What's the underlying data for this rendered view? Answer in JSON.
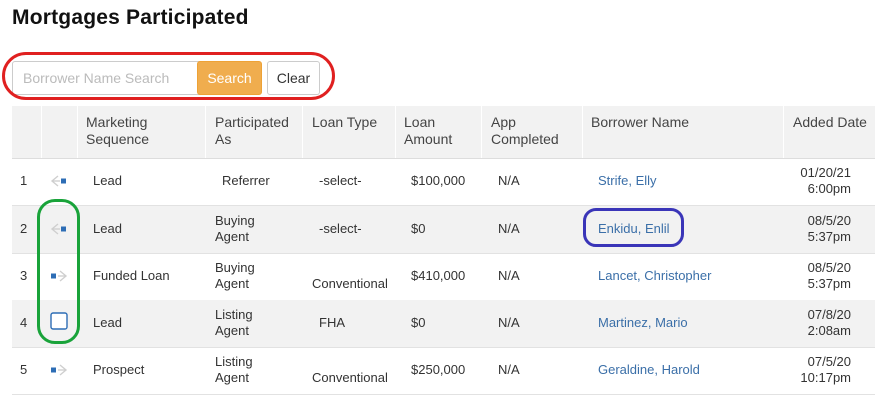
{
  "page_title": "Mortgages Participated",
  "search": {
    "placeholder": "Borrower Name Search",
    "value": "",
    "search_label": "Search",
    "clear_label": "Clear"
  },
  "table": {
    "headers": {
      "num": "",
      "icon": "",
      "marketing_sequence": "Marketing\nSequence",
      "participated_as": "Participated\nAs",
      "loan_type": "Loan Type",
      "loan_amount": "Loan\nAmount",
      "app_completed": "App\nCompleted",
      "borrower_name": "Borrower Name",
      "added_date": "Added Date"
    },
    "rows": [
      {
        "num": "1",
        "icon": "arrow-left-icon",
        "marketing_sequence": "Lead",
        "participated_as": "Referrer",
        "loan_type": "-select-",
        "loan_amount": "$100,000",
        "app_completed": "N/A",
        "borrower_name": "Strife, Elly",
        "added_date": "01/20/21\n6:00pm"
      },
      {
        "num": "2",
        "icon": "arrow-left-icon",
        "marketing_sequence": "Lead",
        "participated_as": "Buying\nAgent",
        "loan_type": "-select-",
        "loan_amount": "$0",
        "app_completed": "N/A",
        "borrower_name": "Enkidu, Enlil",
        "added_date": "08/5/20\n5:37pm"
      },
      {
        "num": "3",
        "icon": "arrow-right-icon",
        "marketing_sequence": "Funded Loan",
        "participated_as": "Buying\nAgent",
        "loan_type": "Conventional",
        "loan_amount": "$410,000",
        "app_completed": "N/A",
        "borrower_name": "Lancet, Christopher",
        "added_date": "08/5/20\n5:37pm"
      },
      {
        "num": "4",
        "icon": "checkbox-icon",
        "marketing_sequence": "Lead",
        "participated_as": "Listing\nAgent",
        "loan_type": "FHA",
        "loan_amount": "$0",
        "app_completed": "N/A",
        "borrower_name": "Martinez, Mario",
        "added_date": "07/8/20\n2:08am"
      },
      {
        "num": "5",
        "icon": "arrow-right-icon",
        "marketing_sequence": "Prospect",
        "participated_as": "Listing\nAgent",
        "loan_type": "Conventional",
        "loan_amount": "$250,000",
        "app_completed": "N/A",
        "borrower_name": "Geraldine, Harold",
        "added_date": "07/5/20\n10:17pm"
      }
    ]
  },
  "colors": {
    "search_button": "#f0ad4e",
    "link": "#3b6fa8",
    "icon_blue": "#2d6db5",
    "red_annotation": "#e02020",
    "blue_annotation": "#3a35b8",
    "green_annotation": "#19a33a"
  }
}
